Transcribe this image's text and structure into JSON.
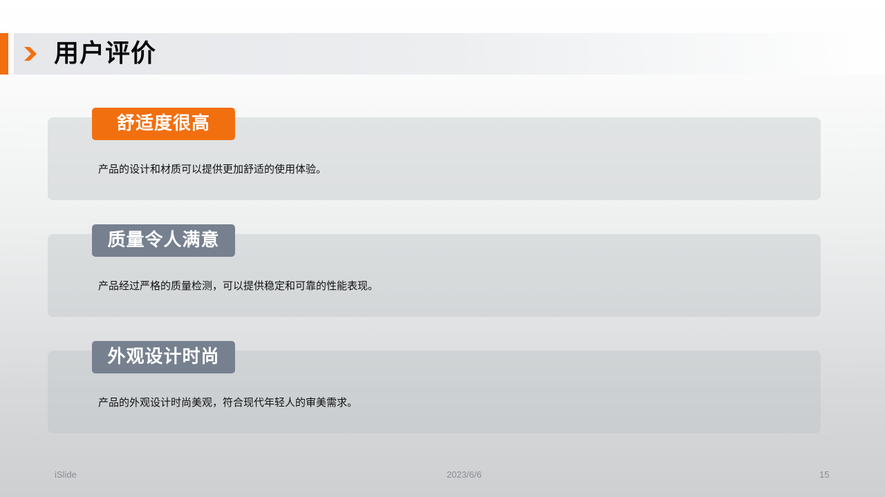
{
  "header": {
    "title": "用户评价",
    "chevron_icon": "chevron-right-icon",
    "accent_color": "#f26f0f"
  },
  "reviews": [
    {
      "tag": "舒适度很高",
      "text": "产品的设计和材质可以提供更加舒适的使用体验。",
      "tag_color": "#f26f0f"
    },
    {
      "tag": "质量令人满意",
      "text": "产品经过严格的质量检测，可以提供稳定和可靠的性能表现。",
      "tag_color": "#76808f"
    },
    {
      "tag": "外观设计时尚",
      "text": "产品的外观设计时尚美观，符合现代年轻人的审美需求。",
      "tag_color": "#76808f"
    }
  ],
  "footer": {
    "brand": "iSlide",
    "date": "2023/6/6",
    "page_number": "15"
  }
}
